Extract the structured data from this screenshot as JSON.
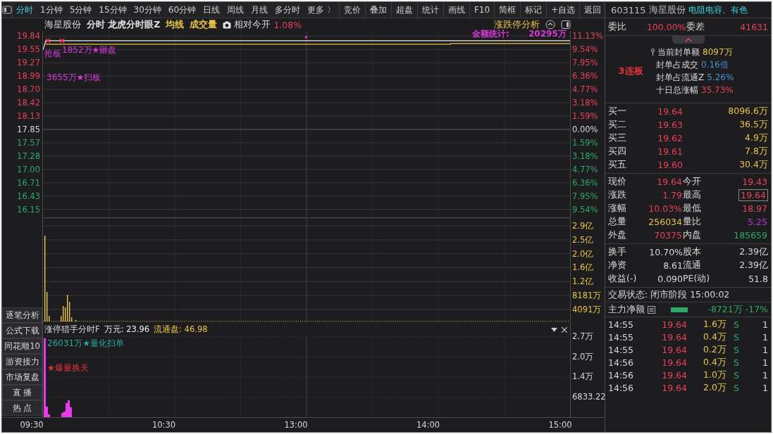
{
  "toolbar": {
    "tabs": [
      {
        "label": "分时",
        "selected": true
      },
      {
        "label": "1分钟",
        "selected": false
      },
      {
        "label": "5分钟",
        "selected": false
      },
      {
        "label": "15分钟",
        "selected": false
      },
      {
        "label": "30分钟",
        "selected": false
      },
      {
        "label": "60分钟",
        "selected": false
      },
      {
        "label": "日线",
        "selected": false
      },
      {
        "label": "周线",
        "selected": false
      },
      {
        "label": "月线",
        "selected": false
      },
      {
        "label": "多分时",
        "selected": false
      }
    ],
    "more": "更多 〉",
    "buttons": [
      "竞价",
      "叠加",
      "超盘",
      "统计",
      "画线",
      "F10",
      "简框",
      "标记",
      "+自选",
      "返回"
    ]
  },
  "chart_header": {
    "stock": "海星股份",
    "items": [
      {
        "text": "分时 龙虎分时眼Z",
        "color": "#e0e0e0"
      },
      {
        "text": "均线",
        "color": "#e8c34a"
      },
      {
        "text": "成交量",
        "color": "#e8c34a"
      }
    ],
    "open_label": "相对今开",
    "open_value": "1.08%",
    "panel_title": "涨跌停分析"
  },
  "price_annotations": [
    {
      "text": "抢板",
      "color": "#d83ad8"
    },
    {
      "text": "1852万★砸盘",
      "color": "#d83ad8"
    },
    {
      "text": "3655万★扫板",
      "color": "#d83ad8"
    },
    {
      "text": "金额统计:",
      "color": "#d83ad8"
    },
    {
      "text": "20295万",
      "color": "#d83ad8"
    }
  ],
  "price_axis": [
    {
      "text": "19.84",
      "color": "#e8405a"
    },
    {
      "text": "19.55",
      "color": "#e8405a"
    },
    {
      "text": "19.27",
      "color": "#e8405a"
    },
    {
      "text": "18.99",
      "color": "#e8405a"
    },
    {
      "text": "18.70",
      "color": "#e8405a"
    },
    {
      "text": "18.42",
      "color": "#e8405a"
    },
    {
      "text": "18.13",
      "color": "#e8405a"
    },
    {
      "text": "17.85",
      "color": "#d8d8d8"
    },
    {
      "text": "17.57",
      "color": "#2fa866"
    },
    {
      "text": "17.28",
      "color": "#2fa866"
    },
    {
      "text": "17.00",
      "color": "#2fa866"
    },
    {
      "text": "16.71",
      "color": "#2fa866"
    },
    {
      "text": "16.43",
      "color": "#2fa866"
    },
    {
      "text": "16.15",
      "color": "#2fa866"
    }
  ],
  "percent_axis": [
    {
      "text": "11.13%",
      "color": "#e8405a"
    },
    {
      "text": "9.54%",
      "color": "#e8405a"
    },
    {
      "text": "7.95%",
      "color": "#e8405a"
    },
    {
      "text": "6.36%",
      "color": "#e8405a"
    },
    {
      "text": "4.77%",
      "color": "#e8405a"
    },
    {
      "text": "3.18%",
      "color": "#e8405a"
    },
    {
      "text": "1.59%",
      "color": "#e8405a"
    },
    {
      "text": "0.00%",
      "color": "#d8d8d8"
    },
    {
      "text": "1.59%",
      "color": "#2fa866"
    },
    {
      "text": "3.18%",
      "color": "#2fa866"
    },
    {
      "text": "4.77%",
      "color": "#2fa866"
    },
    {
      "text": "6.36%",
      "color": "#2fa866"
    },
    {
      "text": "7.95%",
      "color": "#2fa866"
    },
    {
      "text": "9.54%",
      "color": "#2fa866"
    }
  ],
  "volume_axis": [
    "2.9亿",
    "2.5亿",
    "2.0亿",
    "1.6亿",
    "1.2亿",
    "8181万",
    "4091万"
  ],
  "indicator": {
    "items": [
      {
        "text": "涨停猎手分时F",
        "color": "#d8d8d8"
      },
      {
        "text": "万元: 23.96",
        "color": "#f0f0f0"
      },
      {
        "text": "流通盘: 46.98",
        "color": "#e8c34a"
      }
    ],
    "labels": [
      {
        "text": "26031万★量化扫单",
        "color": "#2aa89a"
      },
      {
        "text": "★爆量换天",
        "color": "#e8303a"
      }
    ],
    "axis": [
      "2.7万",
      "2.0万",
      "1.4万",
      "6833.22"
    ]
  },
  "sidebar": [
    "逐笔分析",
    "公式下载",
    "同花顺10",
    "游资接力",
    "市场复盘",
    "直 播",
    "热 点"
  ],
  "time_axis": [
    "09:30",
    "10:30",
    "13:00",
    "14:00",
    "15:00"
  ],
  "quote_panel": {
    "code": "603115",
    "name": "海星股份",
    "sector": "电阻电容、有色",
    "order_ratio": [
      {
        "text": "委比",
        "color": "#d8d8d8"
      },
      {
        "text": "100.00%",
        "color": "#e8405a"
      },
      {
        "text": "委差",
        "color": "#d8d8d8"
      },
      {
        "text": "41631",
        "color": "#e8405a"
      }
    ],
    "streak": "3连板",
    "seal_info": [
      {
        "label": "当前封单额",
        "value": "8097万",
        "color": "#e8c34a"
      },
      {
        "label": "封单占成交",
        "value": "0.16倍",
        "color": "#4a8fd8"
      },
      {
        "label": "封单占流通Z",
        "value": "5.26%",
        "color": "#4a8fd8"
      },
      {
        "label": "十日总涨幅",
        "value": "35.73%",
        "color": "#e8405a"
      }
    ],
    "bids": [
      {
        "label": "买一",
        "price": "19.64",
        "volume": "8096.6万"
      },
      {
        "label": "买二",
        "price": "19.63",
        "volume": "36.5万"
      },
      {
        "label": "买三",
        "price": "19.62",
        "volume": "4.9万"
      },
      {
        "label": "买四",
        "price": "19.61",
        "volume": "7.8万"
      },
      {
        "label": "买五",
        "price": "19.60",
        "volume": "30.4万"
      }
    ],
    "quotes": [
      {
        "label": "现价",
        "value": "19.64",
        "color": "#e8405a",
        "boxed": false
      },
      {
        "label": "今开",
        "value": "19.43",
        "color": "#e8405a",
        "boxed": false
      },
      {
        "label": "涨跌",
        "value": "1.79",
        "color": "#e8405a",
        "boxed": false
      },
      {
        "label": "最高",
        "value": "19.64",
        "color": "#e8405a",
        "boxed": true
      },
      {
        "label": "涨幅",
        "value": "10.03%",
        "color": "#e8405a",
        "boxed": false
      },
      {
        "label": "最低",
        "value": "18.97",
        "color": "#e8405a",
        "boxed": false
      },
      {
        "label": "总量",
        "value": "256034",
        "color": "#e8c34a",
        "boxed": false
      },
      {
        "label": "量比",
        "value": "5.25",
        "color": "#b23cd8",
        "boxed": false
      },
      {
        "label": "外盘",
        "value": "70375",
        "color": "#e8405a",
        "boxed": false
      },
      {
        "label": "内盘",
        "value": "185659",
        "color": "#2fa866",
        "boxed": false
      }
    ],
    "stats": [
      {
        "label": "换手",
        "value": "10.70%"
      },
      {
        "label": "股本",
        "value": "2.39亿"
      },
      {
        "label": "净资",
        "value": "8.61"
      },
      {
        "label": "流通",
        "value": "2.39亿"
      },
      {
        "label": "收益(-)",
        "value": "0.090"
      },
      {
        "label": "PE(动)",
        "value": "51.8"
      }
    ],
    "trade_status": "交易状态: 闭市阶段 15:00:02",
    "main_net": {
      "label": "主力净额",
      "value": "-8721万 -17%"
    },
    "ticks": [
      {
        "time": "14:55",
        "price": "19.64",
        "volume": "1.6万",
        "side": "S",
        "count": "1"
      },
      {
        "time": "14:55",
        "price": "19.64",
        "volume": "0.4万",
        "side": "S",
        "count": "1"
      },
      {
        "time": "14:55",
        "price": "19.64",
        "volume": "0.2万",
        "side": "S",
        "count": "1"
      },
      {
        "time": "14:56",
        "price": "19.64",
        "volume": "0.4万",
        "side": "S",
        "count": "1"
      },
      {
        "time": "14:56",
        "price": "19.64",
        "volume": "1.0万",
        "side": "S",
        "count": "1"
      },
      {
        "time": "14:56",
        "price": "19.64",
        "volume": "2.0万",
        "side": "S",
        "count": "1"
      }
    ]
  }
}
